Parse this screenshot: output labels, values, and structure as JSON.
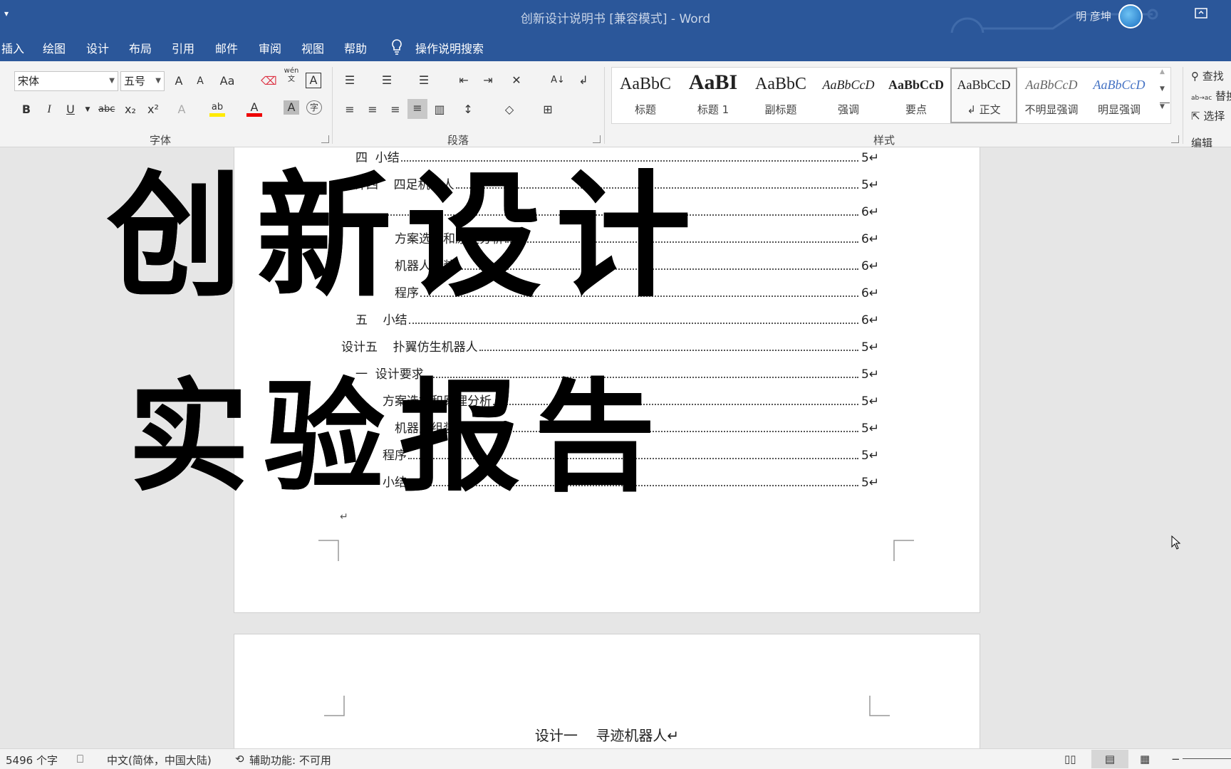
{
  "titlebar": {
    "qat": "▾",
    "title": "创新设计说明书 [兼容模式]  -  Word",
    "user": "明 彦坤",
    "restore_icon": "ribbon-display-icon"
  },
  "tabs": [
    "插入",
    "绘图",
    "设计",
    "布局",
    "引用",
    "邮件",
    "审阅",
    "视图",
    "帮助"
  ],
  "tell_me": "操作说明搜索",
  "font": {
    "name": "宋体",
    "size": "五号",
    "grow": "A",
    "shrink": "A",
    "case": "Aa",
    "phonetic": "wén",
    "phonetic_sub": "文",
    "border_char": "A",
    "bold": "B",
    "italic": "I",
    "underline": "U",
    "strike": "abc",
    "sub": "x₂",
    "sup": "x²",
    "effects": "A",
    "highlight": "ab",
    "color": "A",
    "shade": "A",
    "enclose": "字",
    "label": "字体"
  },
  "paragraph": {
    "label": "段落",
    "sort": "A↓",
    "marks": "↲"
  },
  "styles": {
    "label": "样式",
    "items": [
      {
        "sample": "AaBbC",
        "name": "标题"
      },
      {
        "sample": "AaBI",
        "name": "标题 1"
      },
      {
        "sample": "AaBbC",
        "name": "副标题"
      },
      {
        "sample": "AaBbCcD",
        "name": "强调"
      },
      {
        "sample": "AaBbCcD",
        "name": "要点"
      },
      {
        "sample": "AaBbCcD",
        "name": "↲ 正文"
      },
      {
        "sample": "AaBbCcD",
        "name": "不明显强调"
      },
      {
        "sample": "AaBbCcD",
        "name": "明显强调"
      }
    ]
  },
  "editing": {
    "find": "查找",
    "replace": "替换",
    "select": "选择",
    "label": "编辑",
    "replace_icon": "ab→ac"
  },
  "toc": [
    {
      "text": "四  小结",
      "page": "5↵"
    },
    {
      "text": "计四    四足机器人",
      "page": "5↵"
    },
    {
      "text": "",
      "page": "6↵"
    },
    {
      "text": "方案选择和原理分析",
      "page": "6↵"
    },
    {
      "text": "机器人组装",
      "page": "6↵"
    },
    {
      "text": "程序",
      "page": "6↵"
    },
    {
      "text": "五    小结",
      "page": "6↵"
    },
    {
      "text": "设计五    扑翼仿生机器人",
      "page": "5↵"
    },
    {
      "text": "一  设计要求",
      "page": "5↵"
    },
    {
      "text": "方案选择和原理分析",
      "page": "5↵"
    },
    {
      "text": "机器人组装",
      "page": "5↵"
    },
    {
      "text": "程序",
      "page": "5↵"
    },
    {
      "text": "小结",
      "page": "5↵"
    }
  ],
  "para_mark": "↵",
  "page2_heading": "设计一    寻迹机器人↵",
  "overlay": {
    "line1": "创新设计",
    "line2": "实验报告"
  },
  "status": {
    "words": "5496 个字",
    "language": "中文(简体，中国大陆)",
    "accessibility": "辅助功能: 不可用"
  },
  "accent_color": "#2b579a"
}
